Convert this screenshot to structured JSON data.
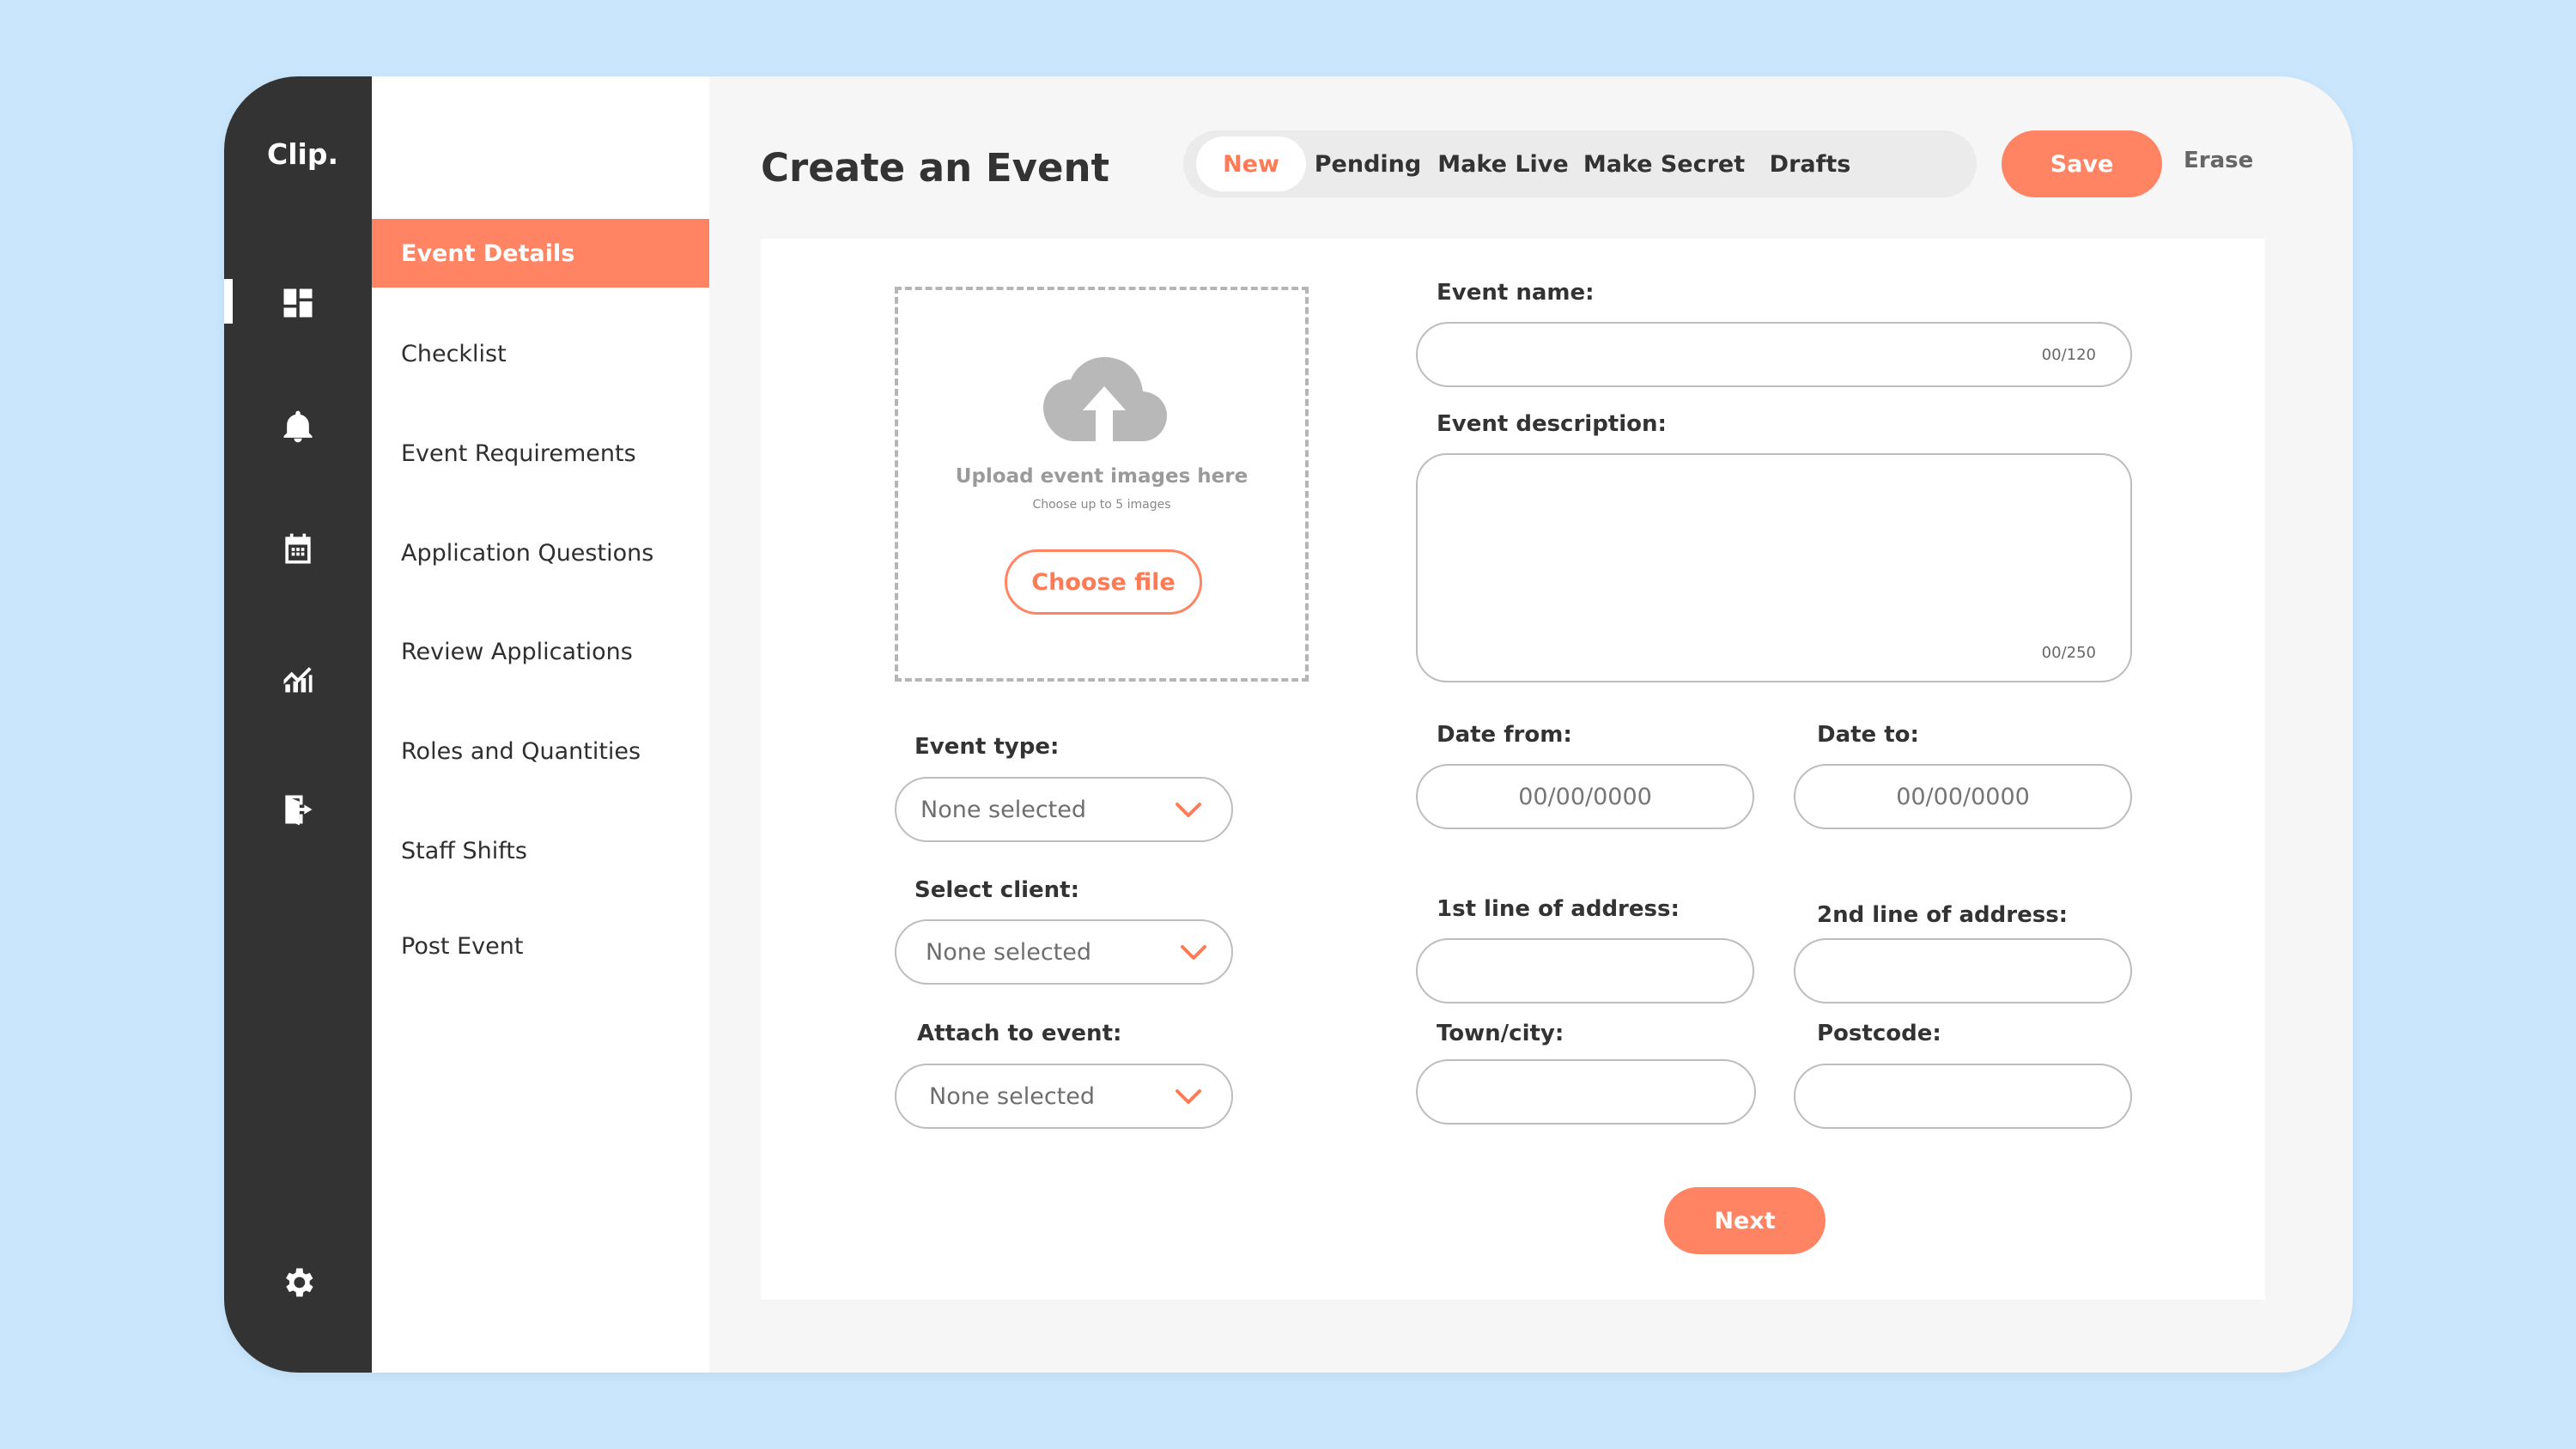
{
  "app": {
    "logo": "Clip."
  },
  "rail": {
    "icons": [
      "dashboard-icon",
      "bell-icon",
      "calendar-icon",
      "chart-icon",
      "logout-icon",
      "gear-icon"
    ],
    "active": "dashboard-icon"
  },
  "subnav": {
    "items": [
      {
        "label": "Event Details",
        "active": true
      },
      {
        "label": "Checklist"
      },
      {
        "label": "Event Requirements"
      },
      {
        "label": "Application Questions"
      },
      {
        "label": "Review Applications"
      },
      {
        "label": "Roles and Quantities"
      },
      {
        "label": "Staff Shifts"
      },
      {
        "label": "Post Event"
      }
    ]
  },
  "header": {
    "title": "Create an Event",
    "tabs": [
      {
        "label": "New",
        "active": true
      },
      {
        "label": "Pending"
      },
      {
        "label": "Make Live"
      },
      {
        "label": "Make Secret"
      },
      {
        "label": "Drafts"
      }
    ],
    "save_label": "Save",
    "erase_label": "Erase"
  },
  "upload": {
    "title": "Upload event images here",
    "hint": "Choose up to 5 images",
    "button_label": "Choose file"
  },
  "form": {
    "event_name": {
      "label": "Event name:",
      "value": "",
      "counter": "00/120"
    },
    "event_description": {
      "label": "Event description:",
      "value": "",
      "counter": "00/250"
    },
    "event_type": {
      "label": "Event type:",
      "value": "None selected"
    },
    "select_client": {
      "label": "Select client:",
      "value": "None selected"
    },
    "attach_to_event": {
      "label": "Attach to event:",
      "value": "None selected"
    },
    "date_from": {
      "label": "Date from:",
      "placeholder": "00/00/0000"
    },
    "date_to": {
      "label": "Date to:",
      "placeholder": "00/00/0000"
    },
    "address_line_1": {
      "label": "1st line of address:",
      "value": ""
    },
    "address_line_2": {
      "label": "2nd line of address:",
      "value": ""
    },
    "town_city": {
      "label": "Town/city:",
      "value": ""
    },
    "postcode": {
      "label": "Postcode:",
      "value": ""
    },
    "next_label": "Next"
  },
  "colors": {
    "accent": "#ff8463",
    "rail": "#333333",
    "background": "#c9e6fd"
  }
}
